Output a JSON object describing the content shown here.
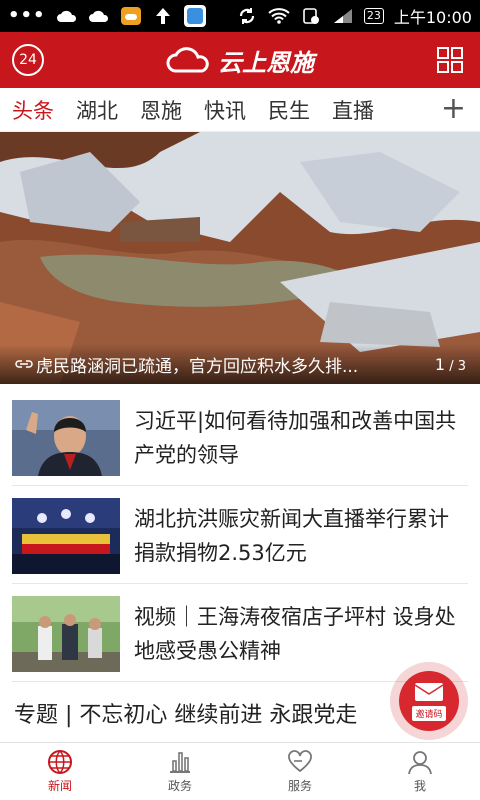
{
  "status_bar": {
    "battery": "23",
    "time": "上午10:00"
  },
  "header": {
    "badge": "24",
    "logo_text": "云上恩施"
  },
  "tabs": [
    {
      "label": "头条",
      "active": true
    },
    {
      "label": "湖北",
      "active": false
    },
    {
      "label": "恩施",
      "active": false
    },
    {
      "label": "快讯",
      "active": false
    },
    {
      "label": "民生",
      "active": false
    },
    {
      "label": "直播",
      "active": false
    }
  ],
  "tab_add_label": "+",
  "hero": {
    "caption": "虎民路涵洞已疏通，官方回应积水多久排...",
    "page_current": "1",
    "page_total": "3"
  },
  "news": [
    {
      "title": "习近平|如何看待加强和改善中国共产党的领导"
    },
    {
      "title": "湖北抗洪赈灾新闻大直播举行累计捐款捐物2.53亿元"
    },
    {
      "title": "视频｜王海涛夜宿店子坪村 设身处地感受愚公精神"
    }
  ],
  "topic": {
    "text": "专题 | 不忘初心 继续前进 永跟党走"
  },
  "invite": {
    "label": "邀请码"
  },
  "bottom_nav": [
    {
      "label": "新闻",
      "icon": "globe-icon",
      "active": true
    },
    {
      "label": "政务",
      "icon": "chart-icon",
      "active": false
    },
    {
      "label": "服务",
      "icon": "heart-hand-icon",
      "active": false
    },
    {
      "label": "我",
      "icon": "person-icon",
      "active": false
    }
  ],
  "colors": {
    "brand_red": "#c8161d"
  }
}
